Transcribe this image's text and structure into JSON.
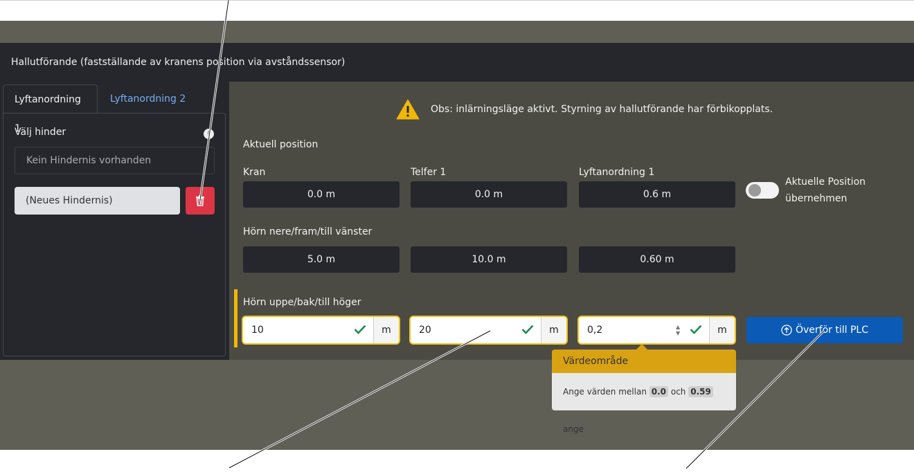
{
  "header": {
    "title": "Hallutförande (fastställande av kranens position via avståndssensor)"
  },
  "tabs": [
    {
      "label": "Lyftanordning 1",
      "active": true
    },
    {
      "label": "Lyftanordning 2",
      "active": false
    }
  ],
  "obstacle": {
    "select_label": "Välj hinder",
    "info_glyph": "i",
    "select_value": "Kein Hindernis vorhanden",
    "new_name": "(Neues Hindernis)"
  },
  "warning": {
    "text": "Obs: inlärningsläge aktivt. Styrning av hallutförande har förbikopplats.",
    "icon": "warning-triangle-icon"
  },
  "current_position": {
    "title": "Aktuell position",
    "fields": [
      {
        "label": "Kran",
        "value": "0.0 m"
      },
      {
        "label": "Telfer 1",
        "value": "0.0 m"
      },
      {
        "label": "Lyftanordning 1",
        "value": "0.6 m"
      }
    ],
    "toggle_label_line1": "Aktuelle Position",
    "toggle_label_line2": "übernehmen",
    "toggle_on": false
  },
  "corner_low": {
    "title": "Hörn nere/fram/till vänster",
    "values": [
      "5.0 m",
      "10.0 m",
      "0.60 m"
    ]
  },
  "corner_high": {
    "title": "Hörn uppe/bak/till höger",
    "inputs": [
      {
        "value": "10",
        "unit": "m"
      },
      {
        "value": "20",
        "unit": "m"
      },
      {
        "value": "0,2",
        "unit": "m"
      }
    ]
  },
  "plc_button": {
    "label": "Överför till PLC",
    "icon": "upload-circle-icon"
  },
  "tooltip": {
    "title": "Värdeområde",
    "prefix": "Ange värden mellan",
    "min": "0.0",
    "middle": "och",
    "max": "0.59",
    "suffix": "ange"
  },
  "colors": {
    "accent": "#f2b705",
    "danger": "#dc3545",
    "primary": "#0b5ab5",
    "valid": "#1f8a4c",
    "link": "#76aef2"
  }
}
